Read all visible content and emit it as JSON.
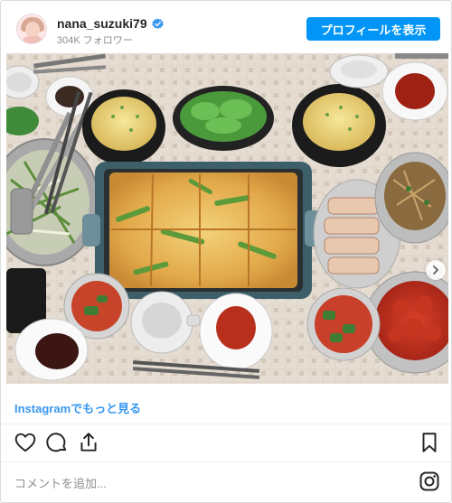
{
  "header": {
    "username": "nana_suzuki79",
    "followers": "304K フォロワー",
    "profile_button": "プロフィールを表示"
  },
  "post": {
    "more_link": "Instagramでもっと見る",
    "comment_placeholder": "コメントを追加..."
  },
  "icons": {
    "verified": "verified-badge-icon",
    "like": "heart-icon",
    "comment": "comment-bubble-icon",
    "share": "share-icon",
    "save": "bookmark-icon",
    "brand": "instagram-icon",
    "carousel": "chevron-right-icon"
  },
  "colors": {
    "accent": "#0095f6",
    "link": "#3897f0",
    "muted": "#8e8e8e"
  }
}
